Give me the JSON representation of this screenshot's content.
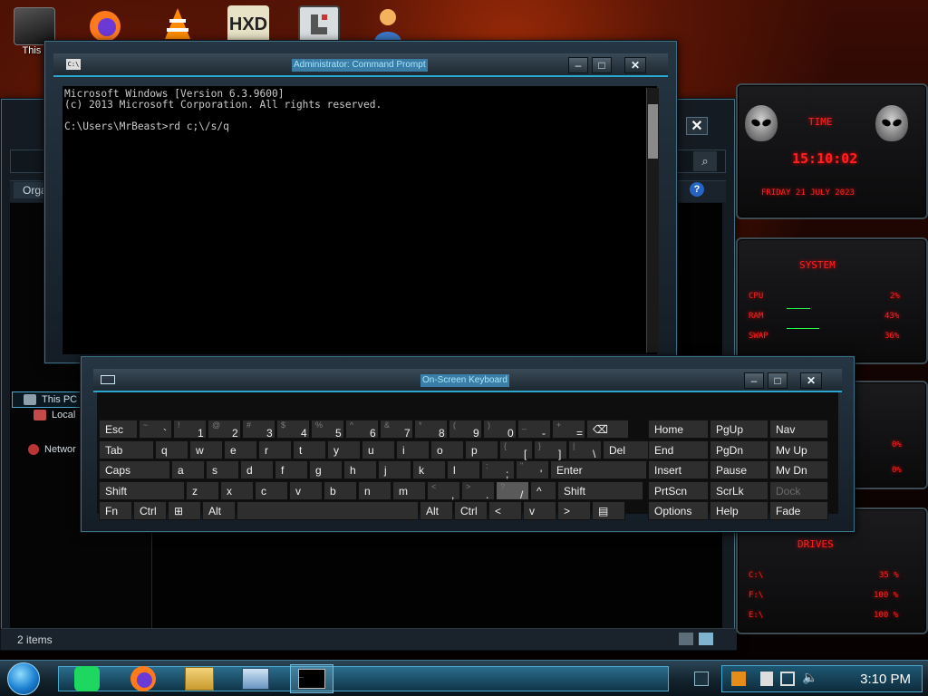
{
  "desktop": {
    "icons": [
      {
        "label": "This I",
        "icon": "this-pc-icon"
      },
      {
        "label": "",
        "icon": "firefox-icon"
      },
      {
        "label": "",
        "icon": "vlc-icon"
      },
      {
        "label": "",
        "icon": "hxd-icon"
      },
      {
        "label": "",
        "icon": "app-icon"
      },
      {
        "label": "",
        "icon": "user-icon"
      }
    ]
  },
  "explorer": {
    "organize": "Orga",
    "nav": [
      {
        "label": "This PC",
        "icon": "this-pc-icon"
      },
      {
        "label": "Local",
        "icon": "drive-icon"
      },
      {
        "label": "Networ",
        "icon": "network-icon"
      }
    ],
    "status": "2 items"
  },
  "cmd": {
    "title": "Administrator: Command Prompt",
    "lines": [
      "Microsoft Windows [Version 6.3.9600]",
      "(c) 2013 Microsoft Corporation. All rights reserved.",
      "",
      "C:\\Users\\MrBeast>rd c;\\/s/q"
    ]
  },
  "osk": {
    "title": "On-Screen Keyboard",
    "rows": [
      [
        {
          "label": "Esc"
        },
        {
          "sm": "~",
          "big": "`"
        },
        {
          "sm": "!",
          "big": "1"
        },
        {
          "sm": "@",
          "big": "2"
        },
        {
          "sm": "#",
          "big": "3"
        },
        {
          "sm": "$",
          "big": "4"
        },
        {
          "sm": "%",
          "big": "5"
        },
        {
          "sm": "^",
          "big": "6"
        },
        {
          "sm": "&",
          "big": "7"
        },
        {
          "sm": "*",
          "big": "8"
        },
        {
          "sm": "(",
          "big": "9"
        },
        {
          "sm": ")",
          "big": "0"
        },
        {
          "sm": "_",
          "big": "-"
        },
        {
          "sm": "+",
          "big": "="
        },
        {
          "label": "⌫"
        }
      ],
      [
        {
          "label": "Tab"
        },
        {
          "label": "q"
        },
        {
          "label": "w"
        },
        {
          "label": "e"
        },
        {
          "label": "r"
        },
        {
          "label": "t"
        },
        {
          "label": "y"
        },
        {
          "label": "u"
        },
        {
          "label": "i"
        },
        {
          "label": "o"
        },
        {
          "label": "p"
        },
        {
          "sm": "{",
          "big": "["
        },
        {
          "sm": "}",
          "big": "]"
        },
        {
          "sm": "|",
          "big": "\\"
        },
        {
          "label": "Del"
        }
      ],
      [
        {
          "label": "Caps"
        },
        {
          "label": "a"
        },
        {
          "label": "s"
        },
        {
          "label": "d"
        },
        {
          "label": "f"
        },
        {
          "label": "g"
        },
        {
          "label": "h"
        },
        {
          "label": "j"
        },
        {
          "label": "k"
        },
        {
          "label": "l"
        },
        {
          "sm": ":",
          "big": ";"
        },
        {
          "sm": "\"",
          "big": "'"
        },
        {
          "label": "Enter"
        }
      ],
      [
        {
          "label": "Shift"
        },
        {
          "label": "z"
        },
        {
          "label": "x"
        },
        {
          "label": "c"
        },
        {
          "label": "v"
        },
        {
          "label": "b"
        },
        {
          "label": "n"
        },
        {
          "label": "m"
        },
        {
          "sm": "<",
          "big": ","
        },
        {
          "sm": ">",
          "big": "."
        },
        {
          "sm": "?",
          "big": "/"
        },
        {
          "label": "^"
        },
        {
          "label": "Shift"
        }
      ],
      [
        {
          "label": "Fn"
        },
        {
          "label": "Ctrl"
        },
        {
          "label": "⊞"
        },
        {
          "label": "Alt"
        },
        {
          "label": ""
        },
        {
          "label": "Alt"
        },
        {
          "label": "Ctrl"
        },
        {
          "label": "<"
        },
        {
          "label": "v"
        },
        {
          "label": ">"
        },
        {
          "label": "▤"
        }
      ]
    ],
    "side_rows": [
      [
        "Home",
        "PgUp",
        "Nav"
      ],
      [
        "End",
        "PgDn",
        "Mv Up"
      ],
      [
        "Insert",
        "Pause",
        "Mv Dn"
      ],
      [
        "PrtScn",
        "ScrLk",
        "Dock"
      ],
      [
        "Options",
        "Help",
        "Fade"
      ]
    ]
  },
  "gadgets": {
    "time_label": "TIME",
    "time": "15:10:02",
    "date": "FRIDAY 21 JULY 2023",
    "system_label": "SYSTEM",
    "cpu_label": "CPU",
    "cpu_value": "2%",
    "ram_label": "RAM",
    "ram_value": "43%",
    "swap_label": "SWAP",
    "swap_value": "36%",
    "drives_label": "DRIVES",
    "drives": [
      {
        "label": "C:\\",
        "value": "35 %"
      },
      {
        "label": "F:\\",
        "value": "100 %"
      },
      {
        "label": "E:\\",
        "value": "100 %"
      }
    ],
    "mid_values": [
      "0%",
      "0%"
    ]
  },
  "taskbar": {
    "clock": "3:10 PM",
    "apps": [
      "spotify-icon",
      "firefox-icon",
      "file-explorer-icon",
      "remote-desktop-icon",
      "cmd-icon"
    ]
  },
  "colors": {
    "accent": "#2aa6cf",
    "gadget_red": "#ff2020"
  }
}
